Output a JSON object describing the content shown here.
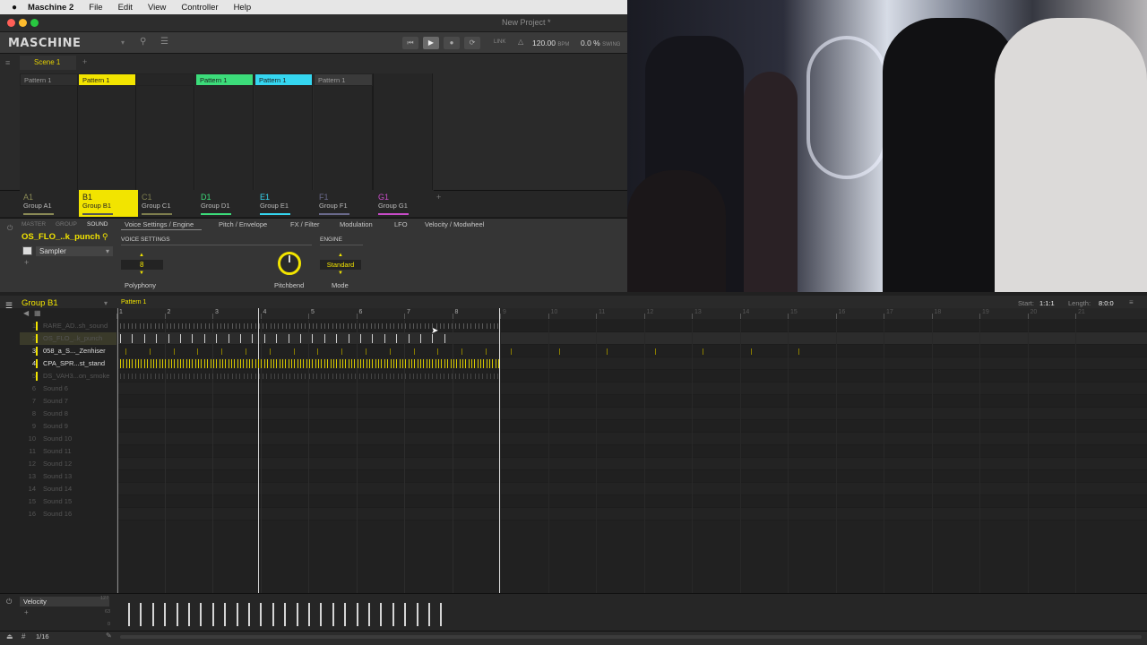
{
  "menubar": {
    "apple": "",
    "app": "Maschine 2",
    "items": [
      "File",
      "Edit",
      "View",
      "Controller",
      "Help"
    ]
  },
  "window": {
    "title": "New Project *"
  },
  "header": {
    "logo": "MASCHINE",
    "link_label": "LINK",
    "tempo": "120.00",
    "tempo_unit": "BPM",
    "swing": "0.0 %",
    "swing_label": "SWING"
  },
  "scenes": {
    "scene_label": "Scene 1",
    "add": "+"
  },
  "patterns": [
    {
      "label": "Pattern 1",
      "color": "#2f2f2f",
      "text": "#999999"
    },
    {
      "label": "Pattern 1",
      "color": "#f2e400",
      "text": "#222222"
    },
    {
      "label": "",
      "color": "#262626",
      "text": "#999999"
    },
    {
      "label": "Pattern 1",
      "color": "#3cdc7a",
      "text": "#1d1d1d"
    },
    {
      "label": "Pattern 1",
      "color": "#35d6f0",
      "text": "#1d1d1d"
    },
    {
      "label": "Pattern 1",
      "color": "#3a3a3a",
      "text": "#9a9a9a"
    }
  ],
  "groups": [
    {
      "letter": "A1",
      "name": "Group A1",
      "color": "#8a8a56",
      "active": false
    },
    {
      "letter": "B1",
      "name": "Group B1",
      "color": "#f2e400",
      "active": true
    },
    {
      "letter": "C1",
      "name": "Group C1",
      "color": "#7e7e4e",
      "active": false
    },
    {
      "letter": "D1",
      "name": "Group D1",
      "color": "#3cdc7a",
      "active": false
    },
    {
      "letter": "E1",
      "name": "Group E1",
      "color": "#35d6f0",
      "active": false
    },
    {
      "letter": "F1",
      "name": "Group F1",
      "color": "#6a6a8c",
      "active": false
    },
    {
      "letter": "G1",
      "name": "Group G1",
      "color": "#c84cc8",
      "active": false
    }
  ],
  "group_add": "+",
  "level_tabs": {
    "master": "MASTER",
    "group": "GROUP",
    "sound": "SOUND"
  },
  "sound": {
    "name": "OS_FLO_..k_punch",
    "plugin": "Sampler"
  },
  "param_tabs": [
    "Voice Settings / Engine",
    "Pitch / Envelope",
    "FX / Filter",
    "Modulation",
    "LFO",
    "Velocity / Modwheel"
  ],
  "params": {
    "voice_settings_label": "VOICE SETTINGS",
    "engine_label": "ENGINE",
    "polyphony_value": "8",
    "polyphony_label": "Polyphony",
    "pitchbend_label": "Pitchbend",
    "mode_value": "Standard",
    "mode_label": "Mode"
  },
  "editor": {
    "group_name": "Group B1",
    "pattern_name": "Pattern 1",
    "start_label": "Start:",
    "start_value": "1:1:1",
    "length_label": "Length:",
    "length_value": "8:0:0",
    "ruler": [
      "1",
      "2",
      "3",
      "4",
      "5",
      "6",
      "7",
      "8",
      "9",
      "10",
      "11",
      "12",
      "13",
      "14",
      "15",
      "16",
      "17",
      "18",
      "19",
      "20",
      "21"
    ],
    "velocity_label": "Velocity",
    "velocity_scale": [
      "127",
      "63",
      "0"
    ],
    "grid": "1/16",
    "add": "+"
  },
  "sounds": [
    {
      "num": "1",
      "name": "RARE_AD..sh_sound",
      "active": false
    },
    {
      "num": "2",
      "name": "OS_FLO_..k_punch",
      "active": false
    },
    {
      "num": "3",
      "name": "058_a_S..._Zenhiser",
      "active": true
    },
    {
      "num": "4",
      "name": "CPA_SPR...st_stand",
      "active": true
    },
    {
      "num": "5",
      "name": "DS_VAH3...on_smoke",
      "active": false
    },
    {
      "num": "6",
      "name": "Sound 6",
      "active": false
    },
    {
      "num": "7",
      "name": "Sound 7",
      "active": false
    },
    {
      "num": "8",
      "name": "Sound 8",
      "active": false
    },
    {
      "num": "9",
      "name": "Sound 9",
      "active": false
    },
    {
      "num": "10",
      "name": "Sound 10",
      "active": false
    },
    {
      "num": "11",
      "name": "Sound 11",
      "active": false
    },
    {
      "num": "12",
      "name": "Sound 12",
      "active": false
    },
    {
      "num": "13",
      "name": "Sound 13",
      "active": false
    },
    {
      "num": "14",
      "name": "Sound 14",
      "active": false
    },
    {
      "num": "15",
      "name": "Sound 15",
      "active": false
    },
    {
      "num": "16",
      "name": "Sound 16",
      "active": false
    }
  ],
  "colors": {
    "accent": "#f2e400",
    "bg": "#212121",
    "panel": "#353535"
  }
}
